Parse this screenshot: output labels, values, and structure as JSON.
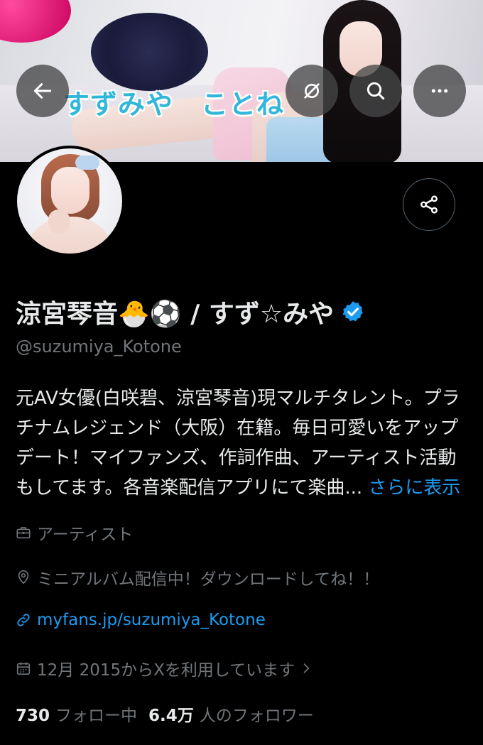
{
  "banner": {
    "title_text": "すずみや　ことね"
  },
  "header_buttons": {
    "back_icon": "arrow-left-icon",
    "hide_icon": "eye-slash-icon",
    "search_icon": "search-icon",
    "more_icon": "more-horizontal-icon"
  },
  "profile": {
    "display_name": "涼宮琴音🐣⚽ / すず☆みや",
    "handle": "@suzumiya_Kotone",
    "verified": true,
    "verified_color": "#1d9bf0",
    "bio_lines": [
      "元AV女優(白咲碧、涼宮琴音)現マルチタレント。プラ",
      "チナムレジェンド（大阪）在籍。毎日可愛いをアップ",
      "デート！マイファンズ、作詞作曲、アーティスト活動",
      "もしてます。各音楽配信アプリにて楽曲..."
    ],
    "bio_more": "さらに表示",
    "category": "アーティスト",
    "location": "ミニアルバム配信中！ダウンロードしてね！！",
    "link": "myfans.jp/suzumiya_Kotone",
    "joined": "12月 2015からXを利用しています",
    "following_count": "730",
    "following_label": "フォロー中",
    "followers_count": "6.4万",
    "followers_label": "人のフォロワー"
  },
  "colors": {
    "background": "#000000",
    "text_primary": "#e7e9ea",
    "text_secondary": "#71767b",
    "link": "#1d9bf0"
  }
}
